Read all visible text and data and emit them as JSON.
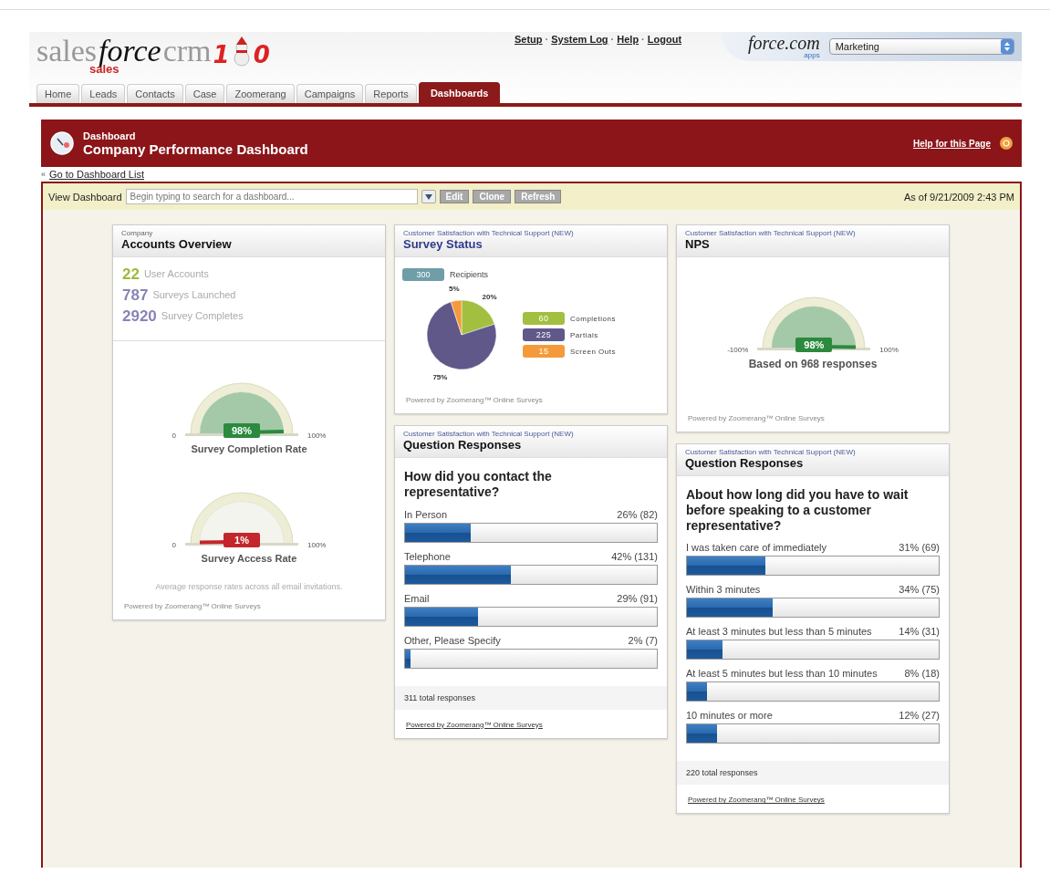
{
  "header": {
    "logo": {
      "word_1": "sales",
      "word_2": "force",
      "word_3": "crm",
      "sub": "sales",
      "mark_1": "1",
      "mark_2": "0"
    },
    "links": [
      "Setup",
      "System Log",
      "Help",
      "Logout"
    ],
    "link_separators": [
      "·",
      "·",
      "·"
    ],
    "brand": {
      "name": "force.com",
      "sub": "apps"
    },
    "app_select": {
      "value": "Marketing"
    }
  },
  "tabs": [
    {
      "label": "Home",
      "selected": false
    },
    {
      "label": "Leads",
      "selected": false
    },
    {
      "label": "Contacts",
      "selected": false
    },
    {
      "label": "Case",
      "selected": false
    },
    {
      "label": "Zoomerang",
      "selected": false
    },
    {
      "label": "Campaigns",
      "selected": false
    },
    {
      "label": "Reports",
      "selected": false
    },
    {
      "label": "Dashboards",
      "selected": true
    }
  ],
  "banner": {
    "kicker": "Dashboard",
    "title": "Company Performance Dashboard",
    "help_link": "Help for this Page"
  },
  "back_link": {
    "arrow": "«",
    "label": "Go to Dashboard List"
  },
  "toolbar": {
    "label": "View Dashboard",
    "search": {
      "placeholder": "Begin typing to search for a dashboard..."
    },
    "buttons": [
      "Edit",
      "Clone",
      "Refresh"
    ],
    "as_of": "As of 9/21/2009 2:43 PM"
  },
  "columns": [
    [
      {
        "kind": "accounts",
        "subtitle": "Company",
        "title": "Accounts Overview",
        "title_link": false,
        "stats": [
          {
            "value": "22",
            "label": "User Accounts",
            "color": "#9cba3c"
          },
          {
            "value": "787",
            "label": "Surveys Launched",
            "color": "#8884b6"
          },
          {
            "value": "2920",
            "label": "Survey Completes",
            "color": "#8884b6"
          }
        ],
        "gauges": [
          {
            "reading": "98%",
            "min": "0",
            "max": "100%",
            "caption": "Survey Completion Rate",
            "color": "#2b8a3e"
          },
          {
            "reading": "1%",
            "min": "0",
            "max": "100%",
            "caption": "Survey Access Rate",
            "color": "#c3262c"
          }
        ],
        "note": "Average response rates across all email invitations.",
        "footer": "Powered by Zoomerang™ Online Surveys"
      }
    ],
    [
      {
        "kind": "survey_status",
        "subtitle": "Customer Satisfaction with Technical Support (NEW)",
        "title": "Survey Status",
        "title_link": true,
        "recipients": {
          "count": "300",
          "label": "Recipients"
        },
        "chart_data": {
          "type": "pie",
          "categories": [
            "Completions",
            "Partials",
            "Screen Outs"
          ],
          "values": [
            20,
            75,
            5
          ],
          "value_labels": [
            "20%",
            "75%",
            "5%"
          ]
        },
        "legend": [
          {
            "count": "60",
            "color": "#a2bf40"
          },
          {
            "count": "225",
            "color": "#5f5889"
          },
          {
            "count": "15",
            "color": "#f59a3a"
          }
        ],
        "footer": "Powered by Zoomerang™ Online Surveys"
      },
      {
        "kind": "question",
        "subtitle": "Customer Satisfaction with Technical Support (NEW)",
        "title": "Question Responses",
        "title_link": false,
        "question": "How did you contact the representative?",
        "answers": [
          {
            "label": "In Person",
            "reading": "26% (82)",
            "level": 0.26
          },
          {
            "label": "Telephone",
            "reading": "42% (131)",
            "level": 0.42
          },
          {
            "label": "Email",
            "reading": "29% (91)",
            "level": 0.29
          },
          {
            "label": "Other, Please Specify",
            "reading": "2% (7)",
            "level": 0.02
          }
        ],
        "total": "311 total responses",
        "footer": "Powered by Zoomerang™ Online Surveys"
      }
    ],
    [
      {
        "kind": "nps",
        "subtitle": "Customer Satisfaction with Technical Support (NEW)",
        "title": "NPS",
        "title_link": false,
        "gauge": {
          "reading": "98%",
          "min": "-100%",
          "max": "100%",
          "color": "#2b8a3e"
        },
        "caption": "Based on 968 responses",
        "footer": "Powered by Zoomerang™ Online Surveys"
      },
      {
        "kind": "question",
        "subtitle": "Customer Satisfaction with Technical Support (NEW)",
        "title": "Question Responses",
        "title_link": false,
        "question": "About how long did you have to wait before speaking to a customer representative?",
        "answers": [
          {
            "label": "I was taken care of immediately",
            "reading": "31% (69)",
            "level": 0.31
          },
          {
            "label": "Within 3 minutes",
            "reading": "34% (75)",
            "level": 0.34
          },
          {
            "label": "At least 3 minutes but less than 5 minutes",
            "reading": "14% (31)",
            "level": 0.14
          },
          {
            "label": "At least 5 minutes but less than 10 minutes",
            "reading": "8% (18)",
            "level": 0.08
          },
          {
            "label": "10 minutes or more",
            "reading": "12% (27)",
            "level": 0.12
          }
        ],
        "total": "220 total responses",
        "footer": "Powered by Zoomerang™ Online Surveys"
      }
    ]
  ]
}
